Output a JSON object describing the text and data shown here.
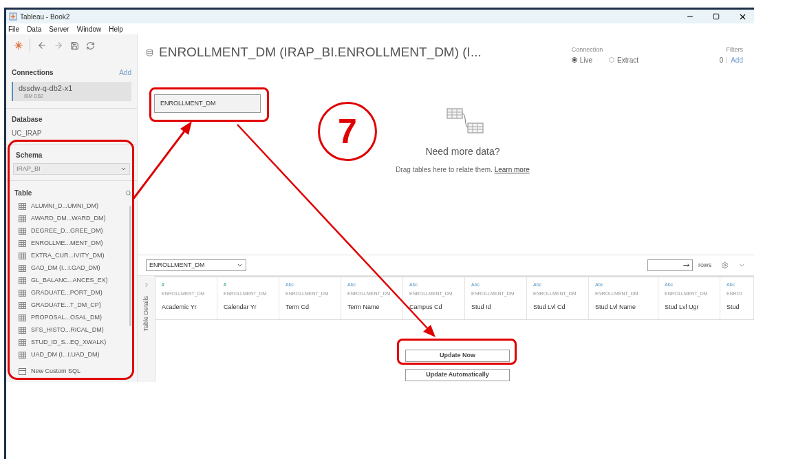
{
  "window": {
    "title": "Tableau - Book2"
  },
  "menu": [
    "File",
    "Data",
    "Server",
    "Window",
    "Help"
  ],
  "sidebar": {
    "connections": {
      "heading": "Connections",
      "add": "Add",
      "items": [
        {
          "name": "dssdw-q-db2-x1",
          "type": "IBM DB2",
          "selected": true
        }
      ]
    },
    "database": {
      "heading": "Database",
      "value": "UC_IRAP"
    },
    "schema": {
      "heading": "Schema",
      "value": "IRAP_BI"
    },
    "table": {
      "heading": "Table",
      "items": [
        "ALUMNI_D...UMNI_DM)",
        "AWARD_DM...WARD_DM)",
        "DEGREE_D...GREE_DM)",
        "ENROLLME...MENT_DM)",
        "EXTRA_CUR...IVITY_DM)",
        "GAD_DM (I...I.GAD_DM)",
        "GL_BALANC...ANCES_EX)",
        "GRADUATE...PORT_DM)",
        "GRADUATE...T_DM_CP)",
        "PROPOSAL...OSAL_DM)",
        "SFS_HISTO...RICAL_DM)",
        "STUD_ID_S...EQ_XWALK)",
        "UAD_DM (I...I.UAD_DM)"
      ]
    },
    "custom_sql": "New Custom SQL"
  },
  "data_source": {
    "title": "ENROLLMENT_DM (IRAP_BI.ENROLLMENT_DM) (I...",
    "connection": {
      "label": "Connection",
      "options": [
        {
          "label": "Live",
          "selected": true
        },
        {
          "label": "Extract",
          "selected": false
        }
      ]
    },
    "filters": {
      "label": "Filters",
      "count": "0",
      "add": "Add"
    }
  },
  "canvas": {
    "tables": [
      "ENROLLMENT_DM"
    ],
    "empty_title": "Need more data?",
    "empty_text": "Drag tables here to relate them.",
    "link": "Learn more"
  },
  "grid": {
    "table_select": "ENROLLMENT_DM",
    "rows_label": "rows",
    "side_label": "Table Details",
    "columns": [
      {
        "kind": "number",
        "type_label": "#",
        "source": "ENROLLMENT_DM",
        "name": "Academic Yr"
      },
      {
        "kind": "number",
        "type_label": "#",
        "source": "ENROLLMENT_DM",
        "name": "Calendar Yr"
      },
      {
        "kind": "string",
        "type_label": "Abc",
        "source": "ENROLLMENT_DM",
        "name": "Term Cd"
      },
      {
        "kind": "string",
        "type_label": "Abc",
        "source": "ENROLLMENT_DM",
        "name": "Term Name"
      },
      {
        "kind": "string",
        "type_label": "Abc",
        "source": "ENROLLMENT_DM",
        "name": "Campus Cd"
      },
      {
        "kind": "string",
        "type_label": "Abc",
        "source": "ENROLLMENT_DM",
        "name": "Stud Id"
      },
      {
        "kind": "string",
        "type_label": "Abc",
        "source": "ENROLLMENT_DM",
        "name": "Stud Lvl Cd"
      },
      {
        "kind": "string",
        "type_label": "Abc",
        "source": "ENROLLMENT_DM",
        "name": "Stud Lvl Name"
      },
      {
        "kind": "string",
        "type_label": "Abc",
        "source": "ENROLLMENT_DM",
        "name": "Stud Lvl Ugr"
      },
      {
        "kind": "string",
        "type_label": "Abc",
        "source": "ENROI",
        "name": "Stud"
      }
    ],
    "buttons": [
      "Update Now",
      "Update Automatically"
    ]
  },
  "annotation": {
    "step": "7"
  }
}
